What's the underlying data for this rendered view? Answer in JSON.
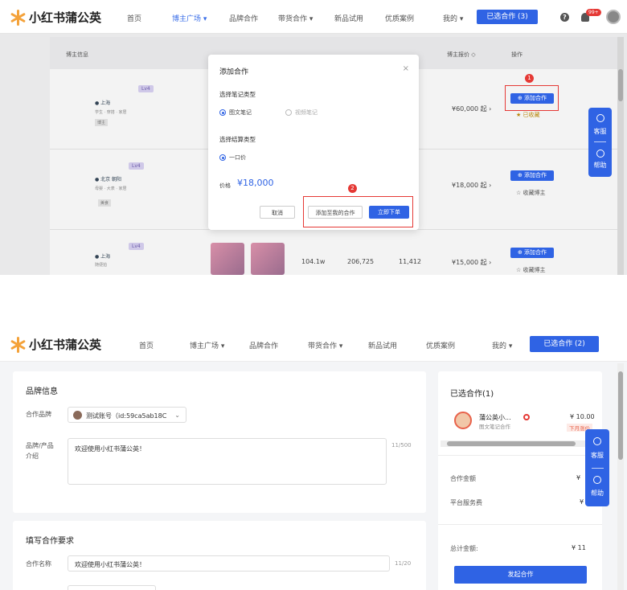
{
  "app": {
    "logo_text": "小红书蒲公英",
    "nav": [
      "首页",
      "博主广场 ▾",
      "品牌合作",
      "带货合作 ▾",
      "新品试用",
      "优质案例",
      "我的 ▾"
    ],
    "selected_button": "已选合作 (3)",
    "notif_badge": "99+",
    "help_icon": "?"
  },
  "shot1": {
    "table": {
      "col_blogger": "博主信息",
      "col_price": "博主报价 ◇",
      "col_op": "操作",
      "rows": [
        {
          "level": "Lv4",
          "name": "● 上海",
          "meta": "学生 · 穿搭 · 家居",
          "chip": "博主",
          "price": "¥60,000 起 ›",
          "action": "⊕ 添加合作",
          "fav": "★ 已收藏"
        },
        {
          "level": "Lv4",
          "name": "● 北京 朝阳",
          "meta": "母婴 · 大表 · 家居",
          "chip": "美食",
          "price": "¥18,000 起 ›",
          "action": "⊕ 添加合作",
          "fav": "☆ 收藏博主"
        },
        {
          "level": "Lv4",
          "name": "● 上海",
          "meta": "随便拍",
          "fans": "104.1w",
          "likes": "206,725",
          "count": "11,412",
          "price": "¥15,000 起 ›",
          "action": "⊕ 添加合作",
          "fav": "☆ 收藏博主"
        }
      ]
    },
    "modal": {
      "title": "添加合作",
      "close": "×",
      "note_type_label": "选择笔记类型",
      "note_type_options": [
        "图文笔记",
        "视频笔记"
      ],
      "settle_label": "选择结算类型",
      "settle_options": [
        "一口价"
      ],
      "price_label": "价格",
      "price_value": "¥18,000",
      "cancel": "取消",
      "add_mine": "添加至我的合作",
      "order_now": "立即下单"
    },
    "markers": [
      "1",
      "2"
    ]
  },
  "float_service": {
    "service": "客服",
    "help": "帮助"
  },
  "shot2": {
    "selected_button": "已选合作 (2)",
    "brand_card": {
      "title": "品牌信息",
      "brand_label": "合作品牌",
      "brand_value": "测试账号（id:59ca5ab18C",
      "intro_label_line1": "品牌/产品",
      "intro_label_line2": "介绍",
      "intro_value": "欢迎使用小红书蒲公英！",
      "intro_counter": "11/500"
    },
    "req_card": {
      "title": "填写合作要求",
      "name_label": "合作名称",
      "name_value": "欢迎使用小红书蒲公英！",
      "name_counter": "11/20"
    },
    "right_card": {
      "title": "已选合作(1)",
      "item_name": "蒲公英小...",
      "item_sub": "图文笔记合作",
      "item_price": "¥ 10.00",
      "item_tag": "下月涨价",
      "amount_label": "合作金额",
      "amount_value": "¥",
      "fee_label": "平台服务费",
      "fee_value": "¥",
      "total_label": "总计金额:",
      "total_value": "¥ 11",
      "launch_button": "发起合作"
    }
  }
}
